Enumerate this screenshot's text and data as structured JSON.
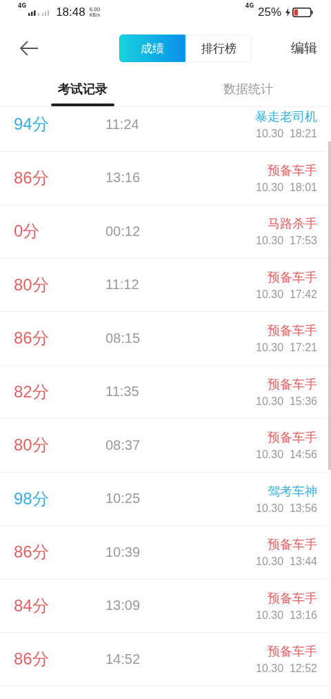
{
  "status_bar": {
    "network": "4G",
    "time": "18:48",
    "speed_value": "6.00",
    "speed_unit": "KB/s",
    "network_right": "4G",
    "battery": "25%"
  },
  "header": {
    "segments": [
      {
        "label": "成绩",
        "selected": true
      },
      {
        "label": "排行榜",
        "selected": false
      }
    ],
    "edit": "编辑"
  },
  "tabs": [
    {
      "label": "考试记录",
      "selected": true
    },
    {
      "label": "数据统计",
      "selected": false
    }
  ],
  "records": [
    {
      "score": "94分",
      "duration": "11:24",
      "title": "暴走老司机",
      "date": "10.30  18:21",
      "passed": true
    },
    {
      "score": "86分",
      "duration": "13:16",
      "title": "预备车手",
      "date": "10.30  18:01",
      "passed": false
    },
    {
      "score": "0分",
      "duration": "00:12",
      "title": "马路杀手",
      "date": "10.30  17:53",
      "passed": false
    },
    {
      "score": "80分",
      "duration": "11:12",
      "title": "预备车手",
      "date": "10.30  17:42",
      "passed": false
    },
    {
      "score": "86分",
      "duration": "08:15",
      "title": "预备车手",
      "date": "10.30  17:21",
      "passed": false
    },
    {
      "score": "82分",
      "duration": "11:35",
      "title": "预备车手",
      "date": "10.30  15:36",
      "passed": false
    },
    {
      "score": "80分",
      "duration": "08:37",
      "title": "预备车手",
      "date": "10.30  14:56",
      "passed": false
    },
    {
      "score": "98分",
      "duration": "10:25",
      "title": "驾考车神",
      "date": "10.30  13:56",
      "passed": true
    },
    {
      "score": "86分",
      "duration": "10:39",
      "title": "预备车手",
      "date": "10.30  13:44",
      "passed": false
    },
    {
      "score": "84分",
      "duration": "13:09",
      "title": "预备车手",
      "date": "10.30  13:16",
      "passed": false
    },
    {
      "score": "86分",
      "duration": "14:52",
      "title": "预备车手",
      "date": "10.30  12:52",
      "passed": false
    }
  ]
}
